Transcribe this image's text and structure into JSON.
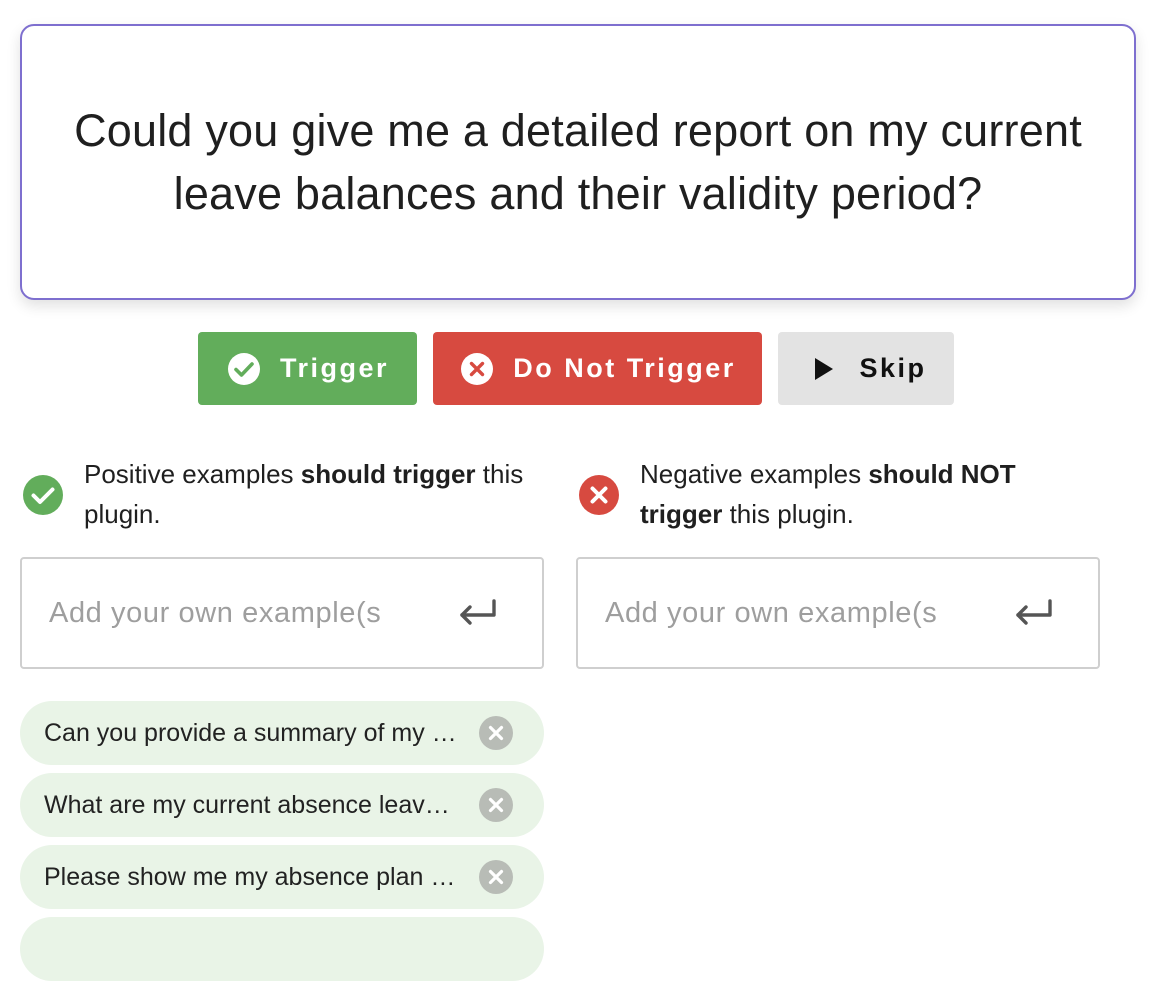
{
  "query": {
    "line1": "Could you give me a detailed report on my current",
    "line2": "leave balances and their validity period?"
  },
  "actions": {
    "trigger_label": "Trigger",
    "do_not_trigger_label": "Do Not Trigger",
    "skip_label": "Skip"
  },
  "hints": {
    "positive": {
      "prefix": "Positive examples ",
      "bold": "should trigger",
      "suffix": " this plugin."
    },
    "negative": {
      "prefix": "Negative examples ",
      "bold": "should NOT trigger",
      "suffix": " this plugin."
    }
  },
  "inputs": {
    "positive_placeholder": "Add your own example(s",
    "negative_placeholder": "Add your own example(s"
  },
  "positive_examples": [
    "Can you provide a summary of my …",
    "What are my current absence leav…",
    "Please show me my absence plan …"
  ],
  "colors": {
    "trigger": "#62ad5b",
    "do_not_trigger": "#d74a40",
    "skip": "#e3e3e3",
    "card_border": "#7e6fcf",
    "chip_bg": "#e9f4e7"
  },
  "icons": {
    "trigger": "check-circle-icon",
    "do_not_trigger": "x-circle-icon",
    "skip": "play-icon",
    "enter": "enter-arrow-icon",
    "chip_remove": "x-circle-icon"
  }
}
